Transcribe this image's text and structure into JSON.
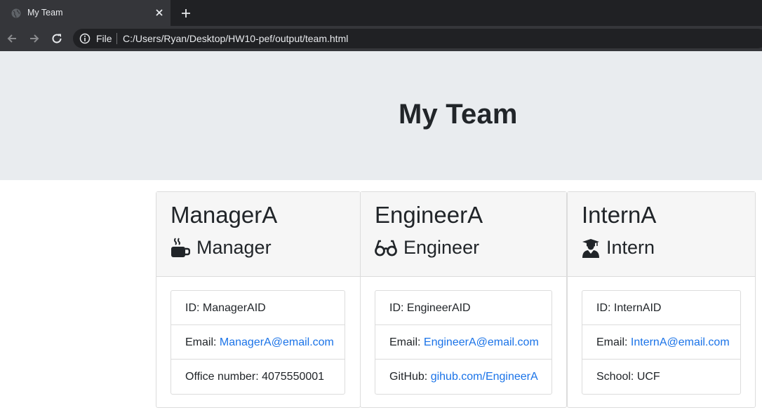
{
  "browser": {
    "tab_title": "My Team",
    "address_scheme_label": "File",
    "address_url": "C:/Users/Ryan/Desktop/HW10-pef/output/team.html"
  },
  "page": {
    "heading": "My Team"
  },
  "team": [
    {
      "name": "ManagerA",
      "role": "Manager",
      "icon": "mug-icon",
      "id_label": "ID: ManagerAID",
      "email_label": "Email: ",
      "email": "ManagerA@email.com",
      "extra_label": "Office number: 4075550001",
      "extra_link": ""
    },
    {
      "name": "EngineerA",
      "role": "Engineer",
      "icon": "glasses-icon",
      "id_label": "ID: EngineerAID",
      "email_label": "Email: ",
      "email": "EngineerA@email.com",
      "extra_label": "GitHub: ",
      "extra_link": "gihub.com/EngineerA"
    },
    {
      "name": "InternA",
      "role": "Intern",
      "icon": "graduate-icon",
      "id_label": "ID: InternAID",
      "email_label": "Email: ",
      "email": "InternA@email.com",
      "extra_label": "School: UCF",
      "extra_link": ""
    }
  ],
  "colors": {
    "jumbotron_bg": "#e9ecef",
    "link": "#1a73e8",
    "text": "#212529"
  }
}
